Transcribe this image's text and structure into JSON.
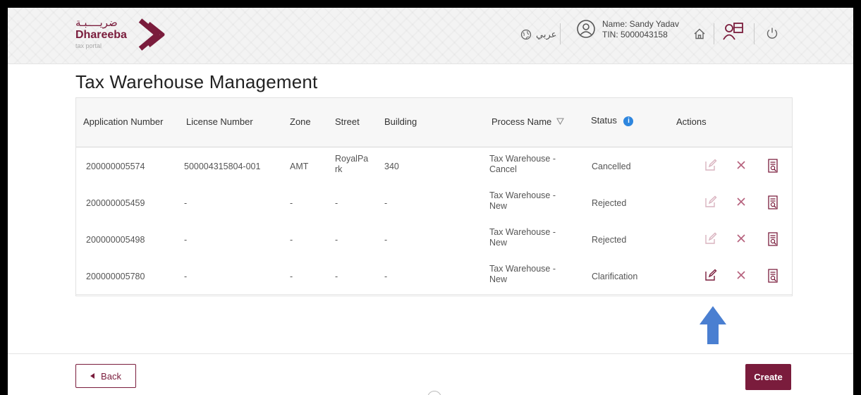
{
  "brand": {
    "arabic": "ضريــــبـة",
    "name": "Dhareeba",
    "sub": "tax portal"
  },
  "header": {
    "language_label": "عربي",
    "user_name": "Name: Sandy Yadav",
    "user_tin": "TIN: 5000043158"
  },
  "page": {
    "title": "Tax Warehouse Management"
  },
  "table": {
    "headers": {
      "application_number": "Application Number",
      "license_number": "License Number",
      "zone": "Zone",
      "street": "Street",
      "building": "Building",
      "process_name": "Process Name",
      "status": "Status",
      "actions": "Actions"
    },
    "rows": [
      {
        "application_number": "200000005574",
        "license_number": "500004315804-001",
        "zone": "AMT",
        "street_1": "RoyalPa",
        "street_2": "rk",
        "building": "340",
        "process_1": "Tax Warehouse -",
        "process_2": "Cancel",
        "status": "Cancelled",
        "edit_enabled": false
      },
      {
        "application_number": "200000005459",
        "license_number": "-",
        "zone": "-",
        "street_1": "-",
        "street_2": "",
        "building": "-",
        "process_1": "Tax Warehouse -",
        "process_2": "New",
        "status": "Rejected",
        "edit_enabled": false
      },
      {
        "application_number": "200000005498",
        "license_number": "-",
        "zone": "-",
        "street_1": "-",
        "street_2": "",
        "building": "-",
        "process_1": "Tax Warehouse -",
        "process_2": "New",
        "status": "Rejected",
        "edit_enabled": false
      },
      {
        "application_number": "200000005780",
        "license_number": "-",
        "zone": "-",
        "street_1": "-",
        "street_2": "",
        "building": "-",
        "process_1": "Tax Warehouse -",
        "process_2": "New",
        "status": "Clarification",
        "edit_enabled": true
      }
    ]
  },
  "footer": {
    "back_label": "Back",
    "create_label": "Create"
  },
  "colors": {
    "brand": "#7a1c3c",
    "info": "#2e86de",
    "arrow": "#4a7fd1"
  },
  "icons": [
    "globe-icon",
    "user-circle-icon",
    "home-icon",
    "switch-account-icon",
    "power-icon",
    "filter-icon",
    "info-icon",
    "edit-icon",
    "close-icon",
    "view-document-icon",
    "arrow-up-icon"
  ]
}
